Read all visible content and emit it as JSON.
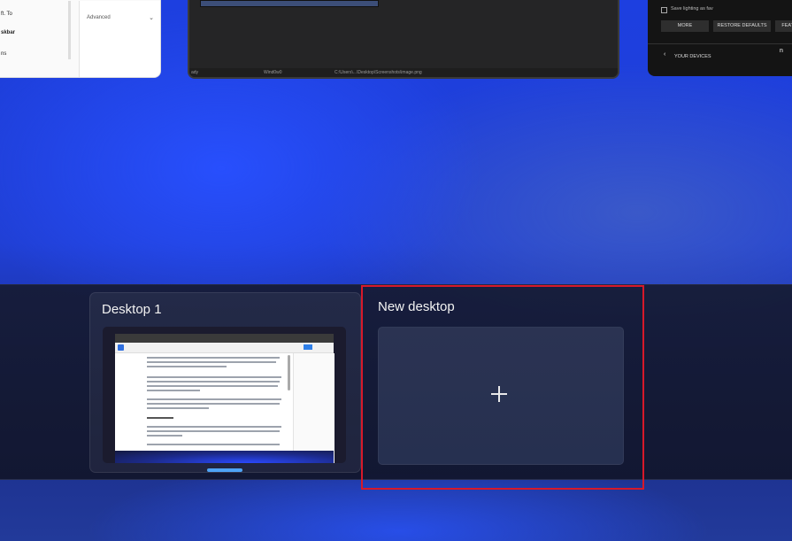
{
  "background_windows": {
    "left": {
      "texts": [
        "ft. To",
        "skbar",
        "ns"
      ],
      "side_texts": [
        "Advanced"
      ],
      "chevron_icon": "chevron-down-icon"
    },
    "middle": {
      "status": [
        "ady",
        "Wind0w0",
        "C:\\Users\\...\\Desktop\\Screenshots\\image.png"
      ]
    },
    "right": {
      "checkbox_label": "Save lighting as fav",
      "buttons": [
        "MORE",
        "RESTORE DEFAULTS",
        "FEATURE"
      ],
      "back_label": "YOUR DEVICES",
      "edge_label": "n"
    }
  },
  "task_view": {
    "desktops": [
      {
        "title": "Desktop 1",
        "active": true
      }
    ],
    "new_desktop": {
      "title": "New desktop",
      "icon": "plus-icon"
    }
  },
  "colors": {
    "highlight_border": "#d6192a",
    "active_indicator": "#4ea3f5",
    "desktop_bar": "#161c38"
  }
}
